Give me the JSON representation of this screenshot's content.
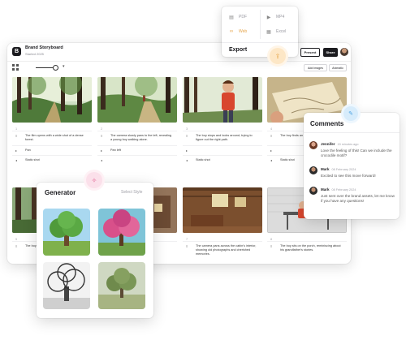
{
  "project": {
    "name": "Brand Storyboard",
    "subtitle": "Started 2025",
    "logo": "B"
  },
  "toolbar": {
    "present": "Present",
    "share": "Share",
    "add_images": "Add images",
    "animatic": "Animatic",
    "zoom_arrow": "▾"
  },
  "export": {
    "title": "Export",
    "items": [
      {
        "label": "PDF",
        "icon": "pdf-icon"
      },
      {
        "label": "MP4",
        "icon": "video-icon"
      },
      {
        "label": "Web",
        "icon": "link-icon"
      },
      {
        "label": "Excel",
        "icon": "table-icon"
      }
    ]
  },
  "shots": [
    {
      "num": "1",
      "desc": "The film opens with a wide shot of a dense forest.",
      "camera": "Pan",
      "shot": "Static shot"
    },
    {
      "num": "2",
      "desc": "The camera slowly pans to the left, revealing a young boy walking alone.",
      "camera": "Pan left",
      "shot": ""
    },
    {
      "num": "3",
      "desc": "The boy stops and looks around, trying to figure out the right path.",
      "camera": "",
      "shot": "Static shot"
    },
    {
      "num": "4",
      "desc": "The boy finds an old map in his backpack.",
      "camera": "",
      "shot": "Static shot"
    },
    {
      "num": "5",
      "desc": "The boy sees",
      "camera": "",
      "shot": ""
    },
    {
      "num": "6",
      "desc": "charming",
      "camera": "",
      "shot": ""
    },
    {
      "num": "7",
      "desc": "The camera pans across the cabin's interior, showing old photographs and cherished memories.",
      "camera": "",
      "shot": ""
    },
    {
      "num": "8",
      "desc": "The boy sits on the porch, reminiscing about his grandfather's stories.",
      "camera": "",
      "shot": ""
    }
  ],
  "comments": {
    "title": "Comments",
    "items": [
      {
        "name": "Jennifer",
        "time": "15 minutes ago",
        "text": "Love the feeling of this! Can we include the crocodile motif?"
      },
      {
        "name": "Mark",
        "time": "08 February 2024",
        "text": "Excited to see this move forward!"
      },
      {
        "name": "Mark",
        "time": "08 February 2024",
        "text": "Just sent over the brand assets, let me know if you have any questions!"
      }
    ]
  },
  "generator": {
    "title": "Generator",
    "select_style": "Select Style"
  },
  "colors": {
    "accent_orange": "#e6a54a",
    "accent_blue": "#4ea4e3",
    "accent_pink": "#e25d8e",
    "dark": "#1b1b1f"
  }
}
